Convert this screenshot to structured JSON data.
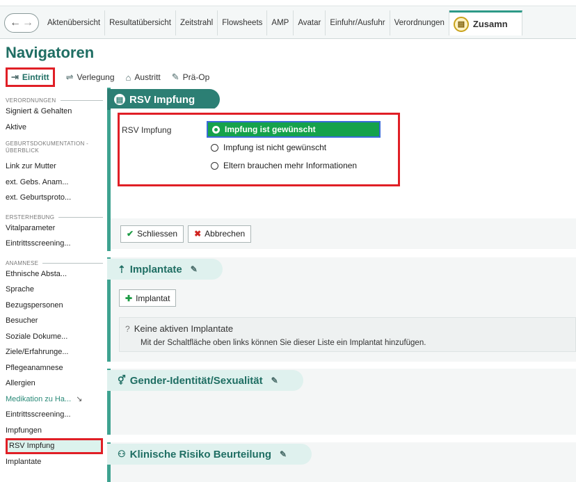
{
  "tabs": [
    "Aktenübersicht",
    "Resultatübersicht",
    "Zeitstrahl",
    "Flowsheets",
    "AMP",
    "Avatar",
    "Einfuhr/Ausfuhr",
    "Verordnungen",
    "Zusamn"
  ],
  "nav_title": "Navigatoren",
  "nav_actions": {
    "eintritt": "Eintritt",
    "verlegung": "Verlegung",
    "austritt": "Austritt",
    "praeop": "Prä-Op"
  },
  "sidebar": {
    "h1": "Verordnungen",
    "i1": "Signiert & Gehalten",
    "i2": "Aktive",
    "h2": "Geburtsdokumentation - Überblick",
    "i3": "Link zur Mutter",
    "i4": "ext. Gebs. Anam...",
    "i5": "ext. Geburtsproto...",
    "h3": "Ersterhebung",
    "i6": "Vitalparameter",
    "i7": "Eintrittsscreening...",
    "h4": "Anamnese",
    "i8": "Ethnische Absta...",
    "i9": "Sprache",
    "i10": "Bezugspersonen",
    "i11": "Besucher",
    "i12": "Soziale Dokume...",
    "i13": "Ziele/Erfahrunge...",
    "i14": "Pflegeanamnese",
    "i15": "Allergien",
    "i16": "Medikation zu Ha...",
    "i17": "Eintrittsscreening...",
    "i18": "Impfungen",
    "i19": "RSV Impfung",
    "i20": "Implantate"
  },
  "rsv": {
    "title": "RSV Impfung",
    "field_label": "RSV Impfung",
    "opt1": "Impfung ist gewünscht",
    "opt2": "Impfung ist nicht gewünscht",
    "opt3": "Eltern brauchen mehr Informationen",
    "close": "Schliessen",
    "cancel": "Abbrechen"
  },
  "implantate": {
    "title": "Implantate",
    "add": "Implantat",
    "empty_title": "Keine aktiven Implantate",
    "empty_text": "Mit der Schaltfläche oben links können Sie dieser Liste ein Implantat hinzufügen."
  },
  "gender": {
    "title": "Gender-Identität/Sexualität"
  },
  "risk": {
    "title": "Klinische Risiko Beurteilung"
  },
  "colors": {
    "accent": "#2c7f74",
    "highlight_red": "#e01f26",
    "selected_green": "#15a24b"
  }
}
